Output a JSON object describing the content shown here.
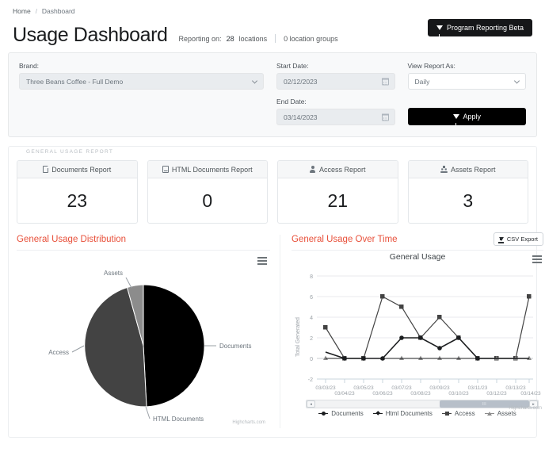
{
  "breadcrumb": {
    "home": "Home",
    "separator": "/",
    "current": "Dashboard"
  },
  "header": {
    "title": "Usage Dashboard",
    "reporting_on_label": "Reporting on:",
    "locations_count": "28",
    "locations_label": "locations",
    "location_groups": "0 location groups",
    "beta_button": "Program Reporting Beta"
  },
  "filters": {
    "brand_label": "Brand:",
    "brand_value": "Three Beans Coffee - Full Demo",
    "start_date_label": "Start Date:",
    "start_date_value": "02/12/2023",
    "end_date_label": "End Date:",
    "end_date_value": "03/14/2023",
    "view_report_label": "View Report As:",
    "view_report_value": "Daily",
    "apply_button": "Apply"
  },
  "report_section": {
    "legend": "GENERAL USAGE REPORT",
    "cards": [
      {
        "title": "Documents Report",
        "value": "23",
        "icon": "document-icon"
      },
      {
        "title": "HTML Documents Report",
        "value": "0",
        "icon": "html-document-icon"
      },
      {
        "title": "Access Report",
        "value": "21",
        "icon": "person-icon"
      },
      {
        "title": "Assets Report",
        "value": "3",
        "icon": "download-icon"
      }
    ]
  },
  "distribution": {
    "heading": "General Usage Distribution",
    "credit": "Highcharts.com"
  },
  "over_time": {
    "heading": "General Usage Over Time",
    "csv_export": "CSV Export",
    "credit": "Highcharts.com",
    "scrollbar": {
      "left_arrow": "◂",
      "right_arrow": "▸",
      "grip": "III"
    }
  },
  "chart_data": [
    {
      "type": "pie",
      "title": "",
      "labels": [
        "Documents",
        "Access",
        "Assets",
        "HTML Documents"
      ],
      "values": [
        23,
        21,
        3,
        0
      ],
      "colors": [
        "#000000",
        "#434343",
        "#8c8c8c",
        "#bfbfbf"
      ],
      "legend_position": "callout-labels",
      "annotations": [
        "Assets",
        "Documents",
        "Access",
        "HTML Documents"
      ]
    },
    {
      "type": "line",
      "title": "General Usage",
      "xlabel": "",
      "ylabel": "Total Generated",
      "ylim": [
        -2,
        8
      ],
      "yticks": [
        -2,
        0,
        2,
        4,
        6,
        8
      ],
      "grid": true,
      "legend_position": "bottom",
      "categories": [
        "03/03/23",
        "03/04/23",
        "03/05/23",
        "03/06/23",
        "03/07/23",
        "03/08/23",
        "03/09/23",
        "03/10/23",
        "03/11/23",
        "03/12/23",
        "03/13/23",
        "03/14/23"
      ],
      "series": [
        {
          "name": "Documents",
          "color": "#1b1d1f",
          "marker": "circle",
          "values": [
            0.6,
            0,
            0,
            0,
            2,
            2,
            1,
            2,
            0,
            0,
            0,
            0
          ]
        },
        {
          "name": "Html Documents",
          "color": "#1b1d1f",
          "marker": "diamond",
          "values": [
            0,
            0,
            0,
            0,
            0,
            0,
            0,
            0,
            0,
            0,
            0,
            0
          ]
        },
        {
          "name": "Access",
          "color": "#434343",
          "marker": "square",
          "values": [
            3,
            0,
            0,
            6,
            5,
            2,
            4,
            2,
            0,
            0,
            0,
            6
          ]
        },
        {
          "name": "Assets",
          "color": "#8c8c8c",
          "marker": "triangle",
          "values": [
            0,
            0,
            0,
            0,
            0,
            0,
            0,
            0,
            0,
            0,
            0,
            0
          ]
        }
      ]
    }
  ]
}
